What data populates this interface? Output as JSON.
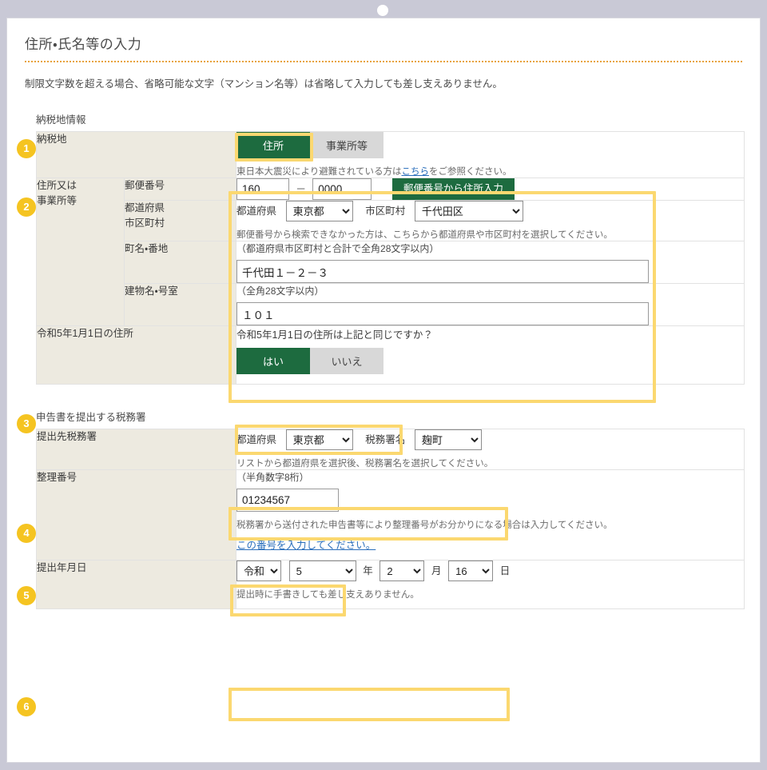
{
  "window": {
    "loading_indicator": "loading-dot"
  },
  "page": {
    "title": "住所・氏名等の入力",
    "intro_note": "制限文字数を超える場合、省略可能な文字（マンション名等）は省略して入力しても差し支えありません。"
  },
  "sections": {
    "tax_place": {
      "heading": "納税地情報",
      "badge1": "1",
      "row1_label": "納税地",
      "toggle_address": "住所",
      "toggle_office": "事業所等",
      "disaster_note_before": "東日本大震災により避難されている方は",
      "disaster_note_link": "こちら",
      "disaster_note_after": "をご参照ください。",
      "badge2": "2",
      "row2_label_line1": "住所又は",
      "row2_label_line2": "事業所等",
      "zip_label": "郵便番号",
      "zip_first": "160",
      "zip_dash": "－",
      "zip_second": "0000",
      "zip_lookup_button": "郵便番号から住所入力",
      "pref_city_label_line1": "都道府県",
      "pref_city_label_line2": "市区町村",
      "pref_select_label": "都道府県",
      "pref_value": "東京都",
      "city_select_label": "市区町村",
      "city_value": "千代田区",
      "pref_city_hint": "郵便番号から検索できなかった方は、こちらから都道府県や市区町村を選択してください。",
      "town_label": "町名・番地",
      "town_limit": "（都道府県市区町村と合計で全角28文字以内）",
      "town_value": "千代田１－２－３",
      "building_label": "建物名・号室",
      "building_limit": "（全角28文字以内）",
      "building_value": "１０１",
      "badge3": "3",
      "row3_label": "令和5年1月1日の住所",
      "row3_question": "令和5年1月1日の住所は上記と同じですか？",
      "answer_yes": "はい",
      "answer_no": "いいえ"
    },
    "tax_office": {
      "heading": "申告書を提出する税務署",
      "badge4": "4",
      "row4_label": "提出先税務署",
      "pref_select_label": "都道府県",
      "pref_value": "東京都",
      "office_select_label": "税務署名",
      "office_value": "麹町",
      "office_hint": "リストから都道府県を選択後、税務署名を選択してください。",
      "badge5": "5",
      "row5_label": "整理番号",
      "seiri_limit": "（半角数字8桁）",
      "seiri_value": "01234567",
      "seiri_hint": "税務署から送付された申告書等により整理番号がお分かりになる場合は入力してください。",
      "seiri_link": "この番号を入力してください。",
      "badge6": "6",
      "row6_label": "提出年月日",
      "era_value": "令和",
      "year_value": "5",
      "year_unit": "年",
      "month_value": "2",
      "month_unit": "月",
      "day_value": "16",
      "day_unit": "日",
      "date_hint": "提出時に手書きしても差し支えありません。"
    }
  },
  "options": {
    "prefectures": [
      "東京都"
    ],
    "cities": [
      "千代田区"
    ],
    "offices": [
      "麹町"
    ],
    "eras": [
      "令和"
    ],
    "years": [
      "5"
    ],
    "months": [
      "2"
    ],
    "days": [
      "16"
    ]
  },
  "colors": {
    "accent_green": "#1d6b3f",
    "highlight_yellow": "#fbd870",
    "badge_yellow": "#f5c421",
    "label_cell": "#edeae0",
    "link_blue": "#2a6ebb",
    "window_bg": "#c9c9d6",
    "title_rule": "#e8a33d"
  }
}
